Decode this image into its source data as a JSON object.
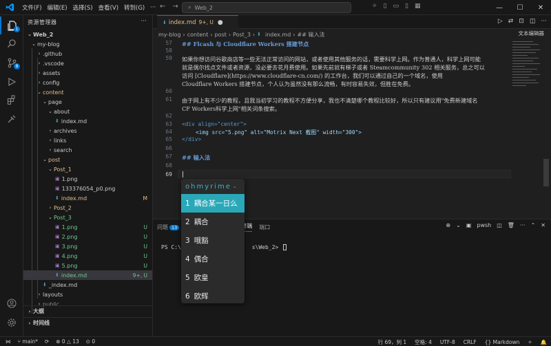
{
  "titlebar": {
    "menu": [
      "文件(F)",
      "编辑(E)",
      "选择(S)",
      "查看(V)",
      "转到(G)"
    ],
    "command_center": "Web_2"
  },
  "activity": {
    "explorer_badge": "1",
    "scm_badge": "8"
  },
  "sidebar": {
    "title": "资源管理器",
    "root": "Web_2",
    "items": [
      {
        "label": "my-blog"
      },
      {
        "label": ".github"
      },
      {
        "label": ".vscode"
      },
      {
        "label": "assets"
      },
      {
        "label": "config"
      },
      {
        "label": "content"
      },
      {
        "label": "page"
      },
      {
        "label": "about"
      },
      {
        "label": "index.md"
      },
      {
        "label": "archives"
      },
      {
        "label": "links"
      },
      {
        "label": "search"
      },
      {
        "label": "post"
      },
      {
        "label": "Post_1"
      },
      {
        "label": "1.png"
      },
      {
        "label": "133376054_p0.png"
      },
      {
        "label": "index.md",
        "git": "M"
      },
      {
        "label": "Post_2"
      },
      {
        "label": "Post_3"
      },
      {
        "label": "1.png",
        "git": "U"
      },
      {
        "label": "2.png",
        "git": "U"
      },
      {
        "label": "3.png",
        "git": "U"
      },
      {
        "label": "4.png",
        "git": "U"
      },
      {
        "label": "5.png",
        "git": "U"
      },
      {
        "label": "index.md",
        "git": "9+, U"
      },
      {
        "label": "_index.md"
      },
      {
        "label": "layouts"
      },
      {
        "label": "public"
      }
    ],
    "outline": "大纲",
    "timeline": "时间线"
  },
  "tab": {
    "filename": "index.md",
    "status": "9+, U"
  },
  "breadcrumb": [
    "my-blog",
    "content",
    "post",
    "Post_3",
    "index.md",
    "## 输入法"
  ],
  "text_editor_btn": "文本编辑器",
  "editor": {
    "lines": [
      {
        "num": "57",
        "text": "## Flcash 与 Cloudflare Workers 搭建节点"
      },
      {
        "num": "58",
        "text": ""
      },
      {
        "num": "59",
        "text": "如果你想访问谷歌商店等一些无法正常访问的网站，或者使用其他服务的话，需要科学上网。作为普通人，科学上网可能"
      },
      {
        "num": "",
        "text": "就是偶尔找点文件或者资源，没必要去花月费使用。如果先前就有梯子或者 Steamcommunity 302 相关服务，总之可以"
      },
      {
        "num": "",
        "text": "访问 [Cloudflare](https://www.cloudflare-cn.com/) 的工作台，我们可以通过自己的一个域名，使用"
      },
      {
        "num": "",
        "text": "Cloudflare Workers 搭建节点，个人认为虽然没有那么流畅，有时容易失效，但胜在免费。"
      },
      {
        "num": "60",
        "text": ""
      },
      {
        "num": "61",
        "text": "由于网上有不少的教程，且我当初学习的教程不方便分享，我也不清楚哪个教程比较好，所以只有建议用\"免费新建域名"
      },
      {
        "num": "",
        "text": "CF Workers科学上网\"相关词条搜索。"
      },
      {
        "num": "62",
        "text": ""
      },
      {
        "num": "63",
        "text": "<div align=\"center\">"
      },
      {
        "num": "64",
        "text": "<img src=\"5.png\" alt=\"Motrix Next 截图\" width=\"300\">"
      },
      {
        "num": "65",
        "text": "</div>"
      },
      {
        "num": "66",
        "text": ""
      },
      {
        "num": "67",
        "text": "## 输入法"
      },
      {
        "num": "68",
        "text": ""
      },
      {
        "num": "69",
        "text": ""
      }
    ]
  },
  "ime": {
    "input": "ohmyrime",
    "candidates": [
      {
        "num": "1",
        "text": "耦合某一日么"
      },
      {
        "num": "2",
        "text": "耦合"
      },
      {
        "num": "3",
        "text": "哦豁"
      },
      {
        "num": "4",
        "text": "偶合"
      },
      {
        "num": "5",
        "text": "欧皇"
      },
      {
        "num": "6",
        "text": "欧辉"
      }
    ]
  },
  "panel": {
    "tabs": [
      "问题",
      "终端",
      "端口"
    ],
    "problems_count": "13",
    "shell": "pwsh",
    "prompt_start": "PS C:\\U",
    "prompt_end": "s\\Web_2> "
  },
  "statusbar": {
    "branch": "main*",
    "errors": "0",
    "warnings": "13",
    "position": "行 69，列 1",
    "spaces": "空格: 4",
    "encoding": "UTF-8",
    "eol": "CRLF",
    "language": "Markdown"
  },
  "colors": {
    "accent": "#0078d4",
    "ime_selected": "#2aa8b8",
    "untracked": "#73c991",
    "modified": "#e2c08d"
  }
}
